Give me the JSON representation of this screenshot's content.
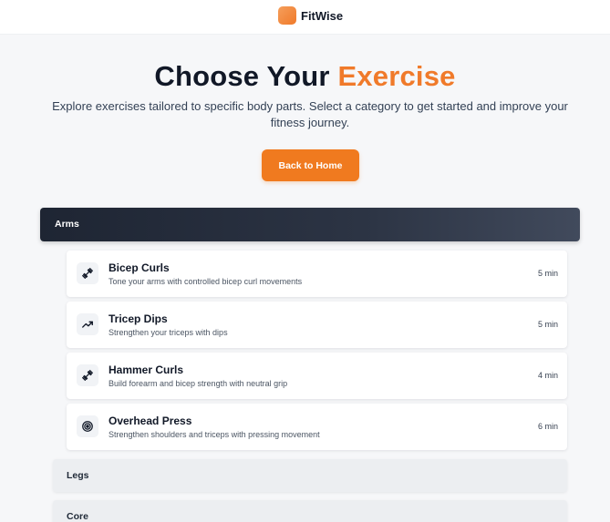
{
  "header": {
    "brand": "FitWise",
    "brand_color": "#f07a2a",
    "logo_icon": "fitwise-logo-icon"
  },
  "hero": {
    "title_prefix": "Choose Your",
    "title_accent": "Exercise",
    "subtitle": "Explore exercises tailored to specific body parts. Select a category to get started and improve your fitness journey.",
    "back_button": "Back to Home"
  },
  "categories": [
    {
      "name": "Arms",
      "expanded": true,
      "exercises": [
        {
          "title": "Bicep Curls",
          "description": "Tone your arms with controlled bicep curl movements",
          "duration": "5 min",
          "icon": "dumbbell-icon"
        },
        {
          "title": "Tricep Dips",
          "description": "Strengthen your triceps with dips",
          "duration": "5 min",
          "icon": "trending-up-icon"
        },
        {
          "title": "Hammer Curls",
          "description": "Build forearm and bicep strength with neutral grip",
          "duration": "4 min",
          "icon": "dumbbell-icon"
        },
        {
          "title": "Overhead Press",
          "description": "Strengthen shoulders and triceps with pressing movement",
          "duration": "6 min",
          "icon": "target-icon"
        }
      ]
    },
    {
      "name": "Legs",
      "expanded": false
    },
    {
      "name": "Core",
      "expanded": false
    }
  ]
}
